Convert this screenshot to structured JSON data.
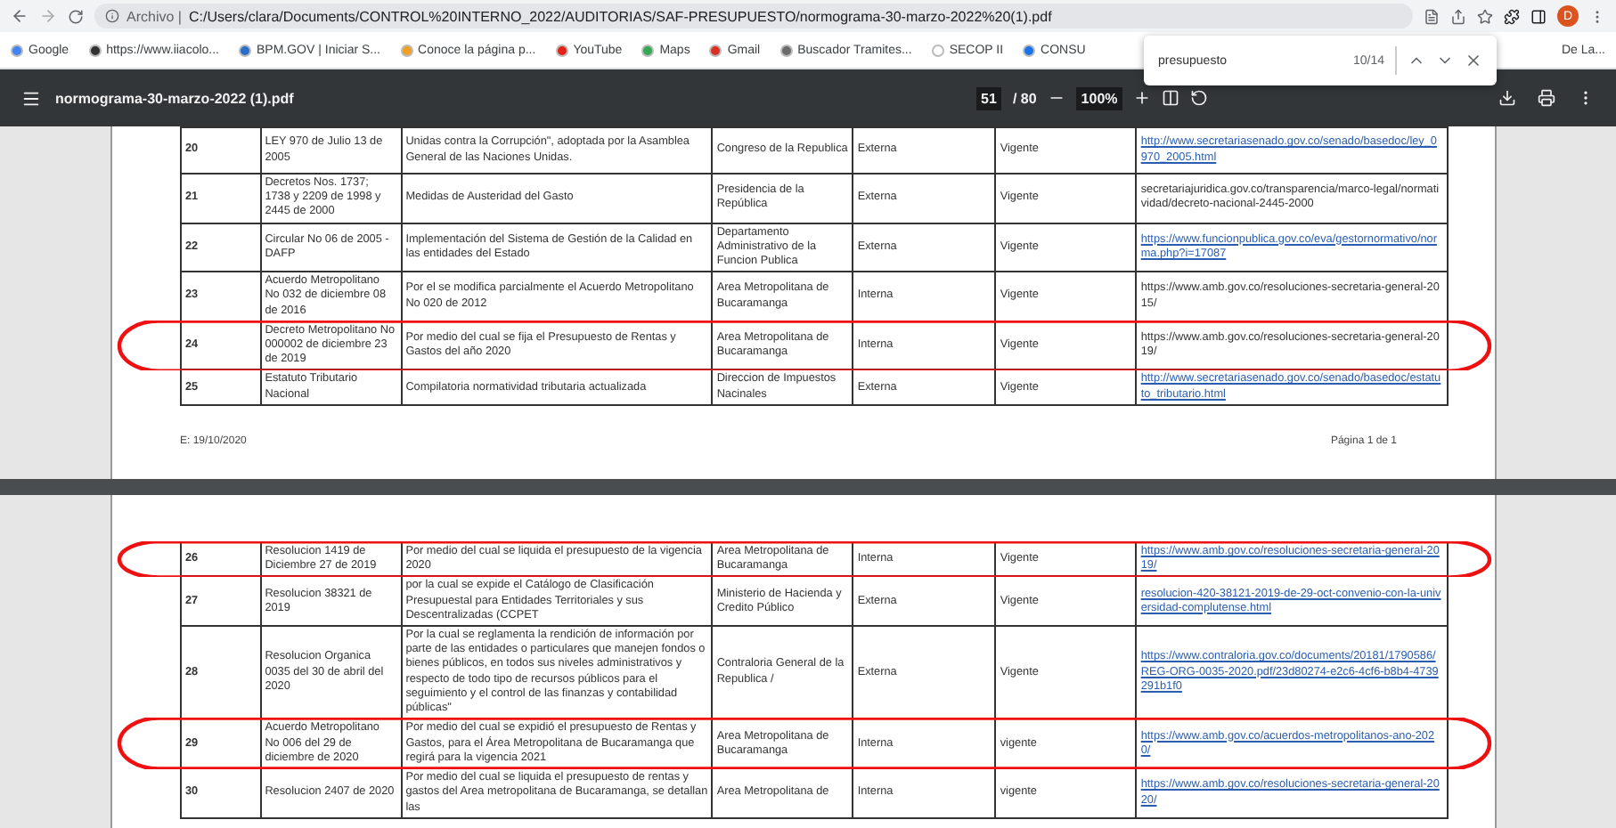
{
  "browser": {
    "site_label": "Archivo |",
    "url": "C:/Users/clara/Documents/CONTROL%20INTERNO_2022/AUDITORIAS/SAF-PRESUPUESTO/normograma-30-marzo-2022%20(1).pdf",
    "profile_initial": "D"
  },
  "bookmarks": [
    {
      "label": "Google",
      "color": "#4285f4"
    },
    {
      "label": "https://www.iiacolo...",
      "color": "#333333"
    },
    {
      "label": "BPM.GOV | Iniciar S...",
      "color": "#2a6fc9"
    },
    {
      "label": "Conoce la página p...",
      "color": "#f0a020"
    },
    {
      "label": "YouTube",
      "color": "#e62117"
    },
    {
      "label": "Maps",
      "color": "#34a853"
    },
    {
      "label": "Gmail",
      "color": "#d93025"
    },
    {
      "label": "Buscador Tramites...",
      "color": "#6b6b6b"
    },
    {
      "label": "SECOP II",
      "color": "#ffffff"
    },
    {
      "label": "CONSU",
      "color": "#1a73e8"
    }
  ],
  "bookmarks_overflow": "De La...",
  "find_bar": {
    "query": "presupuesto",
    "count": "10/14"
  },
  "pdf_toolbar": {
    "file_name": "normograma-30-marzo-2022 (1).pdf",
    "page": "51",
    "page_total": "/ 80",
    "zoom": "100%"
  },
  "pages": [
    {
      "rows": [
        {
          "cells": [
            "20",
            "LEY 970 de Julio 13 de  2005",
            "Unidas contra la Corrupción\", adoptada por la Asamblea General de las Naciones Unidas.",
            "Congreso de la Republica",
            "Externa",
            "Vigente"
          ],
          "link": {
            "text": "http://www.secretariasenado.gov.co/senado/basedoc/ley_0970_2005.html",
            "linked": true
          },
          "highlighted": false
        },
        {
          "cells": [
            "21",
            "Decretos  Nos. 1737; 1738 y 2209 de 1998 y 2445 de 2000",
            "Medidas de Austeridad del Gasto",
            "Presidencia de la República",
            "Externa",
            "Vigente"
          ],
          "link": {
            "text": "secretariajuridica.gov.co/transparencia/marco-legal/normatividad/decreto-nacional-2445-2000",
            "linked": false
          },
          "highlighted": false
        },
        {
          "cells": [
            "22",
            "Circular No 06 de 2005 - DAFP",
            "Implementación del Sistema de Gestión de la Calidad en las entidades del Estado",
            "Departamento Administrativo de la Funcion Publica",
            "Externa",
            "Vigente"
          ],
          "link": {
            "text": "https://www.funcionpublica.gov.co/eva/gestornormativo/norma.php?i=17087",
            "linked": true
          },
          "highlighted": false
        },
        {
          "cells": [
            "23",
            "Acuerdo Metropolitano No 032 de diciembre 08 de 2016",
            "Por el se modifica parcialmente el Acuerdo Metropolitano No 020 de 2012",
            "Area Metropolitana de Bucaramanga",
            "Interna",
            "Vigente"
          ],
          "link": {
            "text": "https://www.amb.gov.co/resoluciones-secretaria-general-2015/",
            "linked": false
          },
          "highlighted": false
        },
        {
          "cells": [
            "24",
            "Decreto Metropolitano No 000002 de diciembre 23 de 2019",
            "Por medio del cual se fija el Presupuesto de Rentas y Gastos del año 2020",
            "Area Metropolitana de Bucaramanga",
            "Interna",
            "Vigente"
          ],
          "link": {
            "text": "https://www.amb.gov.co/resoluciones-secretaria-general-2019/",
            "linked": false
          },
          "highlighted": true
        },
        {
          "cells": [
            "25",
            "Estatuto Tributario Nacional",
            "Compilatoria normatividad tributaria actualizada",
            "Direccion de Impuestos Nacinales",
            "Externa",
            "Vigente"
          ],
          "link": {
            "text": "http://www.secretariasenado.gov.co/senado/basedoc/estatuto_tributario.html",
            "linked": true
          },
          "highlighted": false
        }
      ],
      "footer_left": "E: 19/10/2020",
      "footer_right": "Página 1 de 1"
    },
    {
      "rows": [
        {
          "cells": [
            "26",
            "Resolucion 1419 de Diciembre 27 de 2019",
            "Por medio del cual se liquida el presupuesto de la vigencia 2020",
            "Area Metropolitana de Bucaramanga",
            "Interna",
            "Vigente"
          ],
          "link": {
            "text": "https://www.amb.gov.co/resoluciones-secretaria-general-2019/",
            "linked": true
          },
          "highlighted": true
        },
        {
          "cells": [
            "27",
            "Resolucion 38321 de 2019",
            "por la cual se expide el Catálogo de Clasificación Presupuestal para Entidades Territoriales y sus Descentralizadas (CCPET",
            "Ministerio de Hacienda y Credito Público",
            "Externa",
            "Vigente"
          ],
          "link": {
            "text": "resolucion-420-38121-2019-de-29-oct-convenio-con-la-universidad-complutense.html",
            "linked": true
          },
          "highlighted": false
        },
        {
          "cells": [
            "28",
            "Resolucion Organica 0035 del 30 de abril del 2020",
            "Por la cual se reglamenta la rendición de información por parte de las entidades o particulares que manejen fondos o bienes públicos, en todos sus niveles administrativos y respecto de todo tipo de recursos públicos para el seguimiento y el control de las finanzas y contabilidad públicas\"",
            "Contraloria General de la Republica /",
            "Externa",
            "Vigente"
          ],
          "link": {
            "text": "https://www.contraloria.gov.co/documents/20181/1790586/REG-ORG-0035-2020.pdf/23d80274-e2c6-4cf6-b8b4-4739291b1f0",
            "linked": true
          },
          "highlighted": false
        },
        {
          "cells": [
            "29",
            "Acuerdo Metropolitano No 006  del 29 de diciembre de 2020",
            "Por medio del cual se expidió el presupuesto de Rentas y Gastos, para el Área Metropolitana de Bucaramanga que regirá para la vigencia 2021",
            "Area Metropolitana de Bucaramanga",
            "Interna",
            "vigente"
          ],
          "link": {
            "text": "https://www.amb.gov.co/acuerdos-metropolitanos-ano-2020/",
            "linked": true
          },
          "highlighted": true
        },
        {
          "cells": [
            "30",
            "Resolucion 2407 de 2020",
            "Por medio del cual se liquida el presupuesto de rentas y gastos del Area metropolitana de Bucaramanga, se detallan las",
            "Area Metropolitana de",
            "Interna",
            "vigente"
          ],
          "link": {
            "text": "https://www.amb.gov.co/resoluciones-secretaria-general-2020/",
            "linked": true
          },
          "highlighted": false
        }
      ]
    }
  ]
}
